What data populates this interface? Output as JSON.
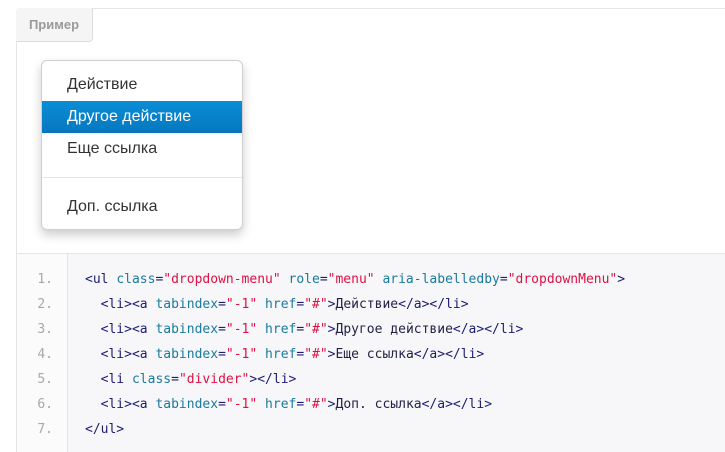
{
  "example": {
    "tab_label": "Пример"
  },
  "dropdown": {
    "items": [
      {
        "label": "Действие",
        "active": false
      },
      {
        "label": "Другое действие",
        "active": true
      },
      {
        "label": "Еще ссылка",
        "active": false
      },
      {
        "label": "Доп. ссылка",
        "active": false
      }
    ],
    "active_color": "#0a81c4"
  },
  "code": {
    "line_numbers": [
      "1.",
      "2.",
      "3.",
      "4.",
      "5.",
      "6.",
      "7."
    ],
    "lines": [
      [
        {
          "t": "tag",
          "v": "<ul "
        },
        {
          "t": "attr",
          "v": "class"
        },
        {
          "t": "tag",
          "v": "="
        },
        {
          "t": "str",
          "v": "\"dropdown-menu\""
        },
        {
          "t": "tag",
          "v": " "
        },
        {
          "t": "attr",
          "v": "role"
        },
        {
          "t": "tag",
          "v": "="
        },
        {
          "t": "str",
          "v": "\"menu\""
        },
        {
          "t": "tag",
          "v": " "
        },
        {
          "t": "attr",
          "v": "aria-labelledby"
        },
        {
          "t": "tag",
          "v": "="
        },
        {
          "t": "str",
          "v": "\"dropdownMenu\""
        },
        {
          "t": "tag",
          "v": ">"
        }
      ],
      [
        {
          "t": "tag",
          "v": "  <li><a "
        },
        {
          "t": "attr",
          "v": "tabindex"
        },
        {
          "t": "tag",
          "v": "="
        },
        {
          "t": "str",
          "v": "\"-1\""
        },
        {
          "t": "tag",
          "v": " "
        },
        {
          "t": "attr",
          "v": "href"
        },
        {
          "t": "tag",
          "v": "="
        },
        {
          "t": "str",
          "v": "\"#\""
        },
        {
          "t": "tag",
          "v": ">"
        },
        {
          "t": "txt",
          "v": "Действие"
        },
        {
          "t": "tag",
          "v": "</a></li>"
        }
      ],
      [
        {
          "t": "tag",
          "v": "  <li><a "
        },
        {
          "t": "attr",
          "v": "tabindex"
        },
        {
          "t": "tag",
          "v": "="
        },
        {
          "t": "str",
          "v": "\"-1\""
        },
        {
          "t": "tag",
          "v": " "
        },
        {
          "t": "attr",
          "v": "href"
        },
        {
          "t": "tag",
          "v": "="
        },
        {
          "t": "str",
          "v": "\"#\""
        },
        {
          "t": "tag",
          "v": ">"
        },
        {
          "t": "txt",
          "v": "Другое действие"
        },
        {
          "t": "tag",
          "v": "</a></li>"
        }
      ],
      [
        {
          "t": "tag",
          "v": "  <li><a "
        },
        {
          "t": "attr",
          "v": "tabindex"
        },
        {
          "t": "tag",
          "v": "="
        },
        {
          "t": "str",
          "v": "\"-1\""
        },
        {
          "t": "tag",
          "v": " "
        },
        {
          "t": "attr",
          "v": "href"
        },
        {
          "t": "tag",
          "v": "="
        },
        {
          "t": "str",
          "v": "\"#\""
        },
        {
          "t": "tag",
          "v": ">"
        },
        {
          "t": "txt",
          "v": "Еще ссылка"
        },
        {
          "t": "tag",
          "v": "</a></li>"
        }
      ],
      [
        {
          "t": "tag",
          "v": "  <li "
        },
        {
          "t": "attr",
          "v": "class"
        },
        {
          "t": "tag",
          "v": "="
        },
        {
          "t": "str",
          "v": "\"divider\""
        },
        {
          "t": "tag",
          "v": "></li>"
        }
      ],
      [
        {
          "t": "tag",
          "v": "  <li><a "
        },
        {
          "t": "attr",
          "v": "tabindex"
        },
        {
          "t": "tag",
          "v": "="
        },
        {
          "t": "str",
          "v": "\"-1\""
        },
        {
          "t": "tag",
          "v": " "
        },
        {
          "t": "attr",
          "v": "href"
        },
        {
          "t": "tag",
          "v": "="
        },
        {
          "t": "str",
          "v": "\"#\""
        },
        {
          "t": "tag",
          "v": ">"
        },
        {
          "t": "txt",
          "v": "Доп. ссылка"
        },
        {
          "t": "tag",
          "v": "</a></li>"
        }
      ],
      [
        {
          "t": "tag",
          "v": "</ul>"
        }
      ]
    ]
  }
}
